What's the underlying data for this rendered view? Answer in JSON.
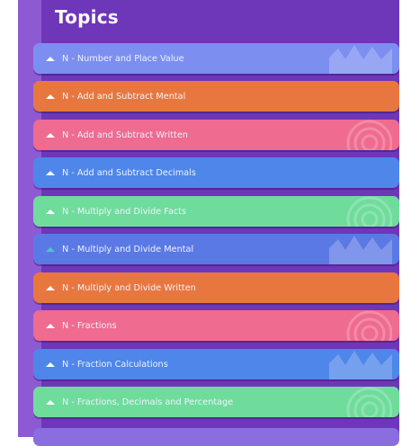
{
  "header": {
    "title": "Topics"
  },
  "topics": [
    {
      "label": "N - Number and Place Value",
      "color": "#7c8ff0"
    },
    {
      "label": "N - Add and Subtract Mental",
      "color": "#e8773f"
    },
    {
      "label": "N - Add and Subtract Written",
      "color": "#ef6b8f"
    },
    {
      "label": "N - Add and Subtract Decimals",
      "color": "#4f86ea"
    },
    {
      "label": "N - Multiply and Divide Facts",
      "color": "#6fdc9b"
    },
    {
      "label": "N - Multiply and Divide Mental",
      "color": "#5b79e4"
    },
    {
      "label": "N - Multiply and Divide Written",
      "color": "#e8773f"
    },
    {
      "label": "N - Fractions",
      "color": "#ef6b8f"
    },
    {
      "label": "N - Fraction Calculations",
      "color": "#4f86ea"
    },
    {
      "label": "N - Fractions, Decimals and Percentage",
      "color": "#6fdc9b"
    }
  ],
  "icons": {
    "expand": "chevron-up-icon"
  }
}
